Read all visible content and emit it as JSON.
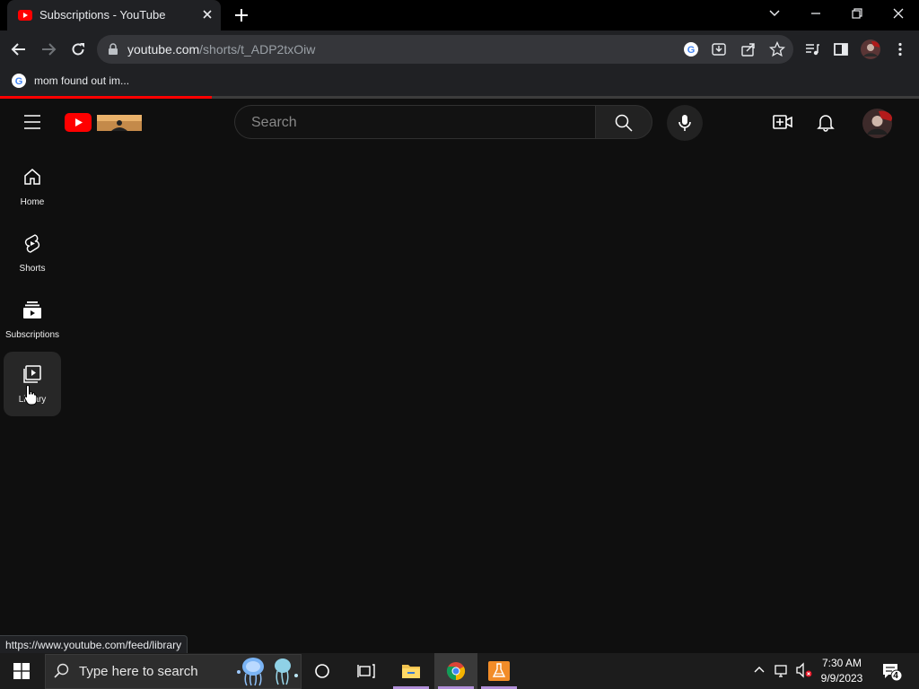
{
  "browser": {
    "tab_title": "Subscriptions - YouTube",
    "url_host": "youtube.com",
    "url_path": "/shorts/t_ADP2txOiw",
    "bookmark_label": "mom found out im..."
  },
  "youtube": {
    "search_placeholder": "Search",
    "sidebar": [
      {
        "label": "Home",
        "icon": "home-icon"
      },
      {
        "label": "Shorts",
        "icon": "shorts-icon"
      },
      {
        "label": "Subscriptions",
        "icon": "subscriptions-icon"
      },
      {
        "label": "Library",
        "icon": "library-icon"
      }
    ],
    "accent_color": "#ff0000"
  },
  "status_bar_url": "https://www.youtube.com/feed/library",
  "taskbar": {
    "search_placeholder": "Type here to search",
    "time": "7:30 AM",
    "date": "9/9/2023",
    "notification_count": "4"
  }
}
